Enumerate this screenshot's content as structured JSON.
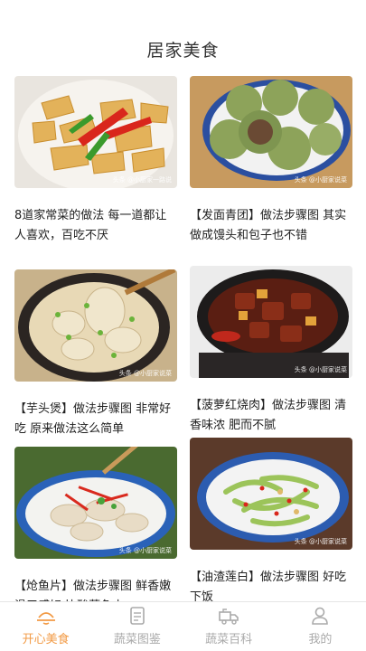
{
  "header": {
    "title": "居家美食"
  },
  "cards": [
    {
      "caption": "8道家常菜的做法 每一道都让人喜欢，百吃不厌",
      "watermark": "头条 @小厨家一路说"
    },
    {
      "caption": "【发面青团】做法步骤图 其实做成馒头和包子也不错",
      "watermark": "头条 @小厨家说菜"
    },
    {
      "caption": "【芋头煲】做法步骤图 非常好吃 原来做法这么简单",
      "watermark": "头条 @小厨家说菜"
    },
    {
      "caption": "【菠萝红烧肉】做法步骤图 清香味浓 肥而不腻",
      "watermark": "头条 @小厨家说菜"
    },
    {
      "caption": "【炝鱼片】做法步骤图 鲜香嫩滑口感好 比酸菜鱼水",
      "watermark": "头条 @小厨家说菜"
    },
    {
      "caption": "【油渣莲白】做法步骤图 好吃下饭",
      "watermark": "头条 @小厨家说菜"
    }
  ],
  "tabs": [
    {
      "label": "开心美食",
      "icon": "smile-bowl-icon",
      "active": true
    },
    {
      "label": "蔬菜图鉴",
      "icon": "document-icon",
      "active": false
    },
    {
      "label": "蔬菜百科",
      "icon": "truck-icon",
      "active": false
    },
    {
      "label": "我的",
      "icon": "user-icon",
      "active": false
    }
  ],
  "colors": {
    "accent": "#f29a44",
    "inactive": "#aaaaaa"
  }
}
